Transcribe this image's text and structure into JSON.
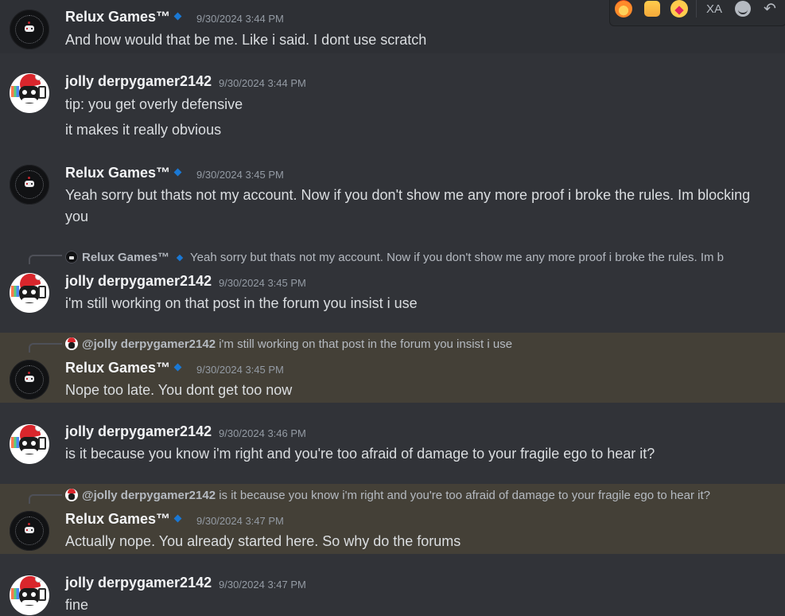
{
  "toolbar": {
    "reactions": [
      "fire-emoji",
      "hand-emoji",
      "heart-emoji"
    ],
    "icons": [
      "translate-icon",
      "add-reaction-icon",
      "reply-icon"
    ],
    "translate_glyph": "XA",
    "reply_glyph": "↶"
  },
  "messages": [
    {
      "author": "Relux Games™",
      "timestamp": "9/30/2024 3:44 PM",
      "lines": [
        "And how would that be me. Like i said. I dont use scratch"
      ]
    },
    {
      "author": "jolly derpygamer2142",
      "timestamp": "9/30/2024 3:44 PM",
      "lines": [
        "tip: you get overly defensive",
        "it makes it really obvious"
      ]
    },
    {
      "author": "Relux Games™",
      "timestamp": "9/30/2024 3:45 PM",
      "lines": [
        "Yeah sorry but thats not my account. Now if you don't show me any more proof i broke the rules. Im blocking",
        "you"
      ]
    },
    {
      "reply_to": {
        "author": "Relux Games™",
        "text": "Yeah sorry but thats not my account. Now if you don't show me any more proof i broke the rules. Im b"
      },
      "author": "jolly derpygamer2142",
      "timestamp": "9/30/2024 3:45 PM",
      "lines": [
        "i'm still working on that post in the forum you insist i use"
      ]
    },
    {
      "reply_to": {
        "author": "@jolly derpygamer2142",
        "text": "i'm still working on that post in the forum you insist i use"
      },
      "author": "Relux Games™",
      "timestamp": "9/30/2024 3:45 PM",
      "lines": [
        "Nope too late. You dont get too now"
      ]
    },
    {
      "author": "jolly derpygamer2142",
      "timestamp": "9/30/2024 3:46 PM",
      "lines": [
        "is it because you know i'm right and you're too afraid of damage to your fragile ego to hear it?"
      ]
    },
    {
      "reply_to": {
        "author": "@jolly derpygamer2142",
        "text": "is it because you know i'm right and you're too afraid of damage to your fragile ego to hear it?"
      },
      "author": "Relux Games™",
      "timestamp": "9/30/2024 3:47 PM",
      "lines": [
        "Actually nope. You already started here. So why do the forums"
      ]
    },
    {
      "author": "jolly derpygamer2142",
      "timestamp": "9/30/2024 3:47 PM",
      "lines": [
        "fine"
      ]
    }
  ]
}
